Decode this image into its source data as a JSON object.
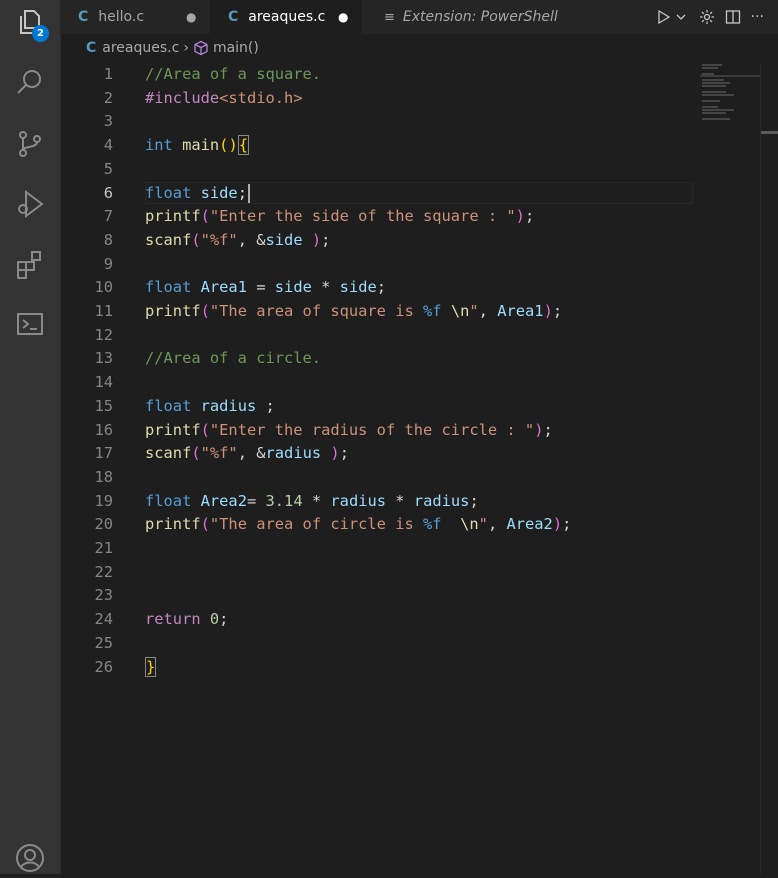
{
  "activity_bar": {
    "explorer_badge": "2",
    "icons": [
      "files-icon",
      "search-icon",
      "source-control-icon",
      "run-debug-icon",
      "extensions-icon",
      "terminal-icon",
      "account-icon"
    ]
  },
  "tabs": [
    {
      "label": "hello.c",
      "file_icon": "C",
      "dirty": true,
      "active": false
    },
    {
      "label": "areaques.c",
      "file_icon": "C",
      "dirty": true,
      "active": true
    },
    {
      "label": "Extension: PowerShell",
      "active": false
    }
  ],
  "breadcrumb": {
    "file_icon": "C",
    "file": "areaques.c",
    "symbol": "main()"
  },
  "editor": {
    "current_line": 6,
    "lines": [
      {
        "n": "1",
        "tokens": [
          [
            "cmt",
            "//Area of a square."
          ]
        ]
      },
      {
        "n": "2",
        "tokens": [
          [
            "pre",
            "#include"
          ],
          [
            "inc",
            "<stdio.h>"
          ]
        ]
      },
      {
        "n": "3",
        "tokens": []
      },
      {
        "n": "4",
        "tokens": [
          [
            "kw",
            "int"
          ],
          [
            "op",
            " "
          ],
          [
            "fn",
            "main"
          ],
          [
            "br1",
            "()"
          ],
          [
            "br1 bracket-match",
            "{"
          ]
        ]
      },
      {
        "n": "5",
        "tokens": []
      },
      {
        "n": "6",
        "tokens": [
          [
            "kw",
            "float"
          ],
          [
            "op",
            " "
          ],
          [
            "var",
            "side"
          ],
          [
            "op",
            ";"
          ]
        ],
        "cursor": true
      },
      {
        "n": "7",
        "tokens": [
          [
            "fn",
            "printf"
          ],
          [
            "br2",
            "("
          ],
          [
            "str",
            "\"Enter the side of the square : \""
          ],
          [
            "br2",
            ")"
          ],
          [
            "op",
            ";"
          ]
        ]
      },
      {
        "n": "8",
        "tokens": [
          [
            "fn",
            "scanf"
          ],
          [
            "br2",
            "("
          ],
          [
            "str",
            "\"%f\""
          ],
          [
            "op",
            ", &"
          ],
          [
            "var",
            "side"
          ],
          [
            "op",
            " "
          ],
          [
            "br2",
            ")"
          ],
          [
            "op",
            ";"
          ]
        ]
      },
      {
        "n": "9",
        "tokens": []
      },
      {
        "n": "10",
        "tokens": [
          [
            "kw",
            "float"
          ],
          [
            "op",
            " "
          ],
          [
            "var",
            "Area1"
          ],
          [
            "op",
            " = "
          ],
          [
            "var",
            "side"
          ],
          [
            "op",
            " * "
          ],
          [
            "var",
            "side"
          ],
          [
            "op",
            ";"
          ]
        ]
      },
      {
        "n": "11",
        "tokens": [
          [
            "fn",
            "printf"
          ],
          [
            "br2",
            "("
          ],
          [
            "str",
            "\"The area of square is "
          ],
          [
            "kw",
            "%f"
          ],
          [
            "str",
            " "
          ],
          [
            "fn",
            "\\n"
          ],
          [
            "str",
            "\""
          ],
          [
            "op",
            ", "
          ],
          [
            "var",
            "Area1"
          ],
          [
            "br2",
            ")"
          ],
          [
            "op",
            ";"
          ]
        ]
      },
      {
        "n": "12",
        "tokens": []
      },
      {
        "n": "13",
        "tokens": [
          [
            "cmt",
            "//Area of a circle."
          ]
        ]
      },
      {
        "n": "14",
        "tokens": []
      },
      {
        "n": "15",
        "tokens": [
          [
            "kw",
            "float"
          ],
          [
            "op",
            " "
          ],
          [
            "var",
            "radius"
          ],
          [
            "op",
            " ;"
          ]
        ]
      },
      {
        "n": "16",
        "tokens": [
          [
            "fn",
            "printf"
          ],
          [
            "br2",
            "("
          ],
          [
            "str",
            "\"Enter the radius of the circle : \""
          ],
          [
            "br2",
            ")"
          ],
          [
            "op",
            ";"
          ]
        ]
      },
      {
        "n": "17",
        "tokens": [
          [
            "fn",
            "scanf"
          ],
          [
            "br2",
            "("
          ],
          [
            "str",
            "\"%f\""
          ],
          [
            "op",
            ", &"
          ],
          [
            "var",
            "radius"
          ],
          [
            "op",
            " "
          ],
          [
            "br2",
            ")"
          ],
          [
            "op",
            ";"
          ]
        ]
      },
      {
        "n": "18",
        "tokens": []
      },
      {
        "n": "19",
        "tokens": [
          [
            "kw",
            "float"
          ],
          [
            "op",
            " "
          ],
          [
            "var",
            "Area2"
          ],
          [
            "op",
            "= "
          ],
          [
            "num",
            "3.14"
          ],
          [
            "op",
            " * "
          ],
          [
            "var",
            "radius"
          ],
          [
            "op",
            " * "
          ],
          [
            "var",
            "radius"
          ],
          [
            "op",
            ";"
          ]
        ]
      },
      {
        "n": "20",
        "tokens": [
          [
            "fn",
            "printf"
          ],
          [
            "br2",
            "("
          ],
          [
            "str",
            "\"The area of circle is "
          ],
          [
            "kw",
            "%f"
          ],
          [
            "str",
            "  "
          ],
          [
            "fn",
            "\\n"
          ],
          [
            "str",
            "\""
          ],
          [
            "op",
            ", "
          ],
          [
            "var",
            "Area2"
          ],
          [
            "br2",
            ")"
          ],
          [
            "op",
            ";"
          ]
        ]
      },
      {
        "n": "21",
        "tokens": []
      },
      {
        "n": "22",
        "tokens": []
      },
      {
        "n": "23",
        "tokens": []
      },
      {
        "n": "24",
        "tokens": [
          [
            "pre",
            "return"
          ],
          [
            "op",
            " "
          ],
          [
            "num",
            "0"
          ],
          [
            "op",
            ";"
          ]
        ]
      },
      {
        "n": "25",
        "tokens": []
      },
      {
        "n": "26",
        "tokens": [
          [
            "br1 bracket-match",
            "}"
          ]
        ]
      }
    ]
  }
}
